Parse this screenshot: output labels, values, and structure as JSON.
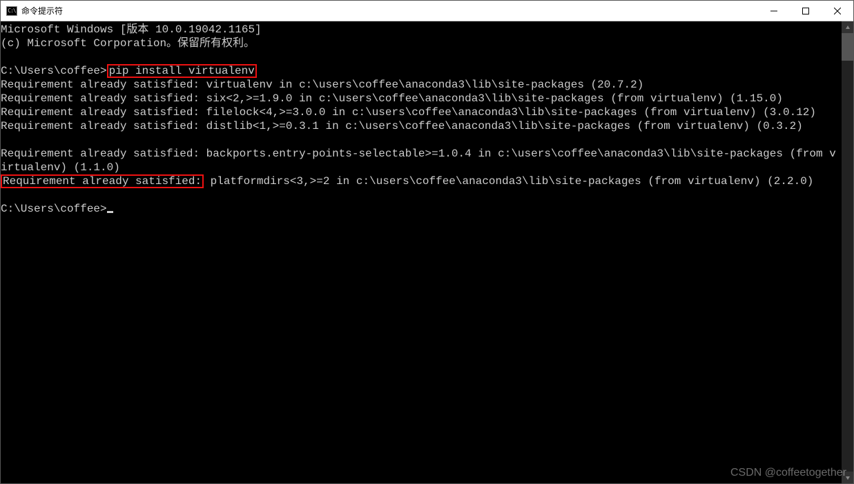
{
  "window": {
    "title": "命令提示符",
    "icon_label": "C:\\"
  },
  "controls": {
    "minimize": "minimize",
    "maximize": "maximize",
    "close": "close"
  },
  "terminal": {
    "header1": "Microsoft Windows [版本 10.0.19042.1165]",
    "header2": "(c) Microsoft Corporation。保留所有权利。",
    "blank": "",
    "prompt1_prefix": "C:\\Users\\coffee>",
    "prompt1_cmd": "pip install virtualenv",
    "out1": "Requirement already satisfied: virtualenv in c:\\users\\coffee\\anaconda3\\lib\\site-packages (20.7.2)",
    "out2": "Requirement already satisfied: six<2,>=1.9.0 in c:\\users\\coffee\\anaconda3\\lib\\site-packages (from virtualenv) (1.15.0)",
    "out3": "Requirement already satisfied: filelock<4,>=3.0.0 in c:\\users\\coffee\\anaconda3\\lib\\site-packages (from virtualenv) (3.0.12)",
    "out4": "Requirement already satisfied: distlib<1,>=0.3.1 in c:\\users\\coffee\\anaconda3\\lib\\site-packages (from virtualenv) (0.3.2)",
    "out5": "Requirement already satisfied: backports.entry-points-selectable>=1.0.4 in c:\\users\\coffee\\anaconda3\\lib\\site-packages (from virtualenv) (1.1.0)",
    "out6_hl": "Requirement already satisfied:",
    "out6_rest": " platformdirs<3,>=2 in c:\\users\\coffee\\anaconda3\\lib\\site-packages (from virtualenv) (2.2.0)",
    "prompt2": "C:\\Users\\coffee>"
  },
  "watermark": "CSDN @coffeetogether"
}
